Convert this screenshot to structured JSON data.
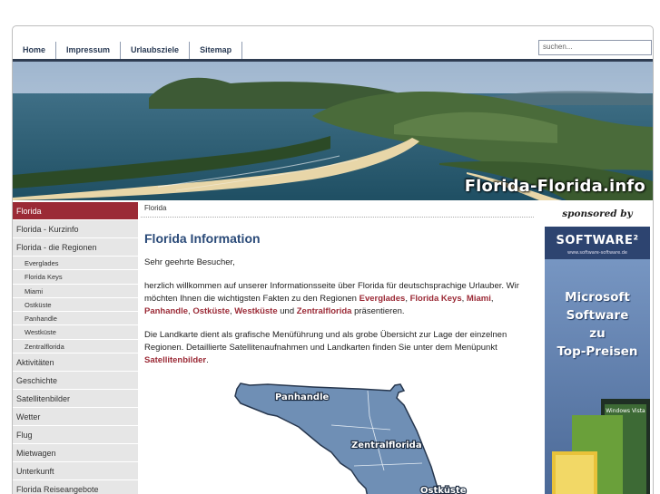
{
  "nav": {
    "items": [
      "Home",
      "Impressum",
      "Urlaubsziele",
      "Sitemap"
    ],
    "search_placeholder": "suchen..."
  },
  "banner": {
    "title": "Florida-Florida.info"
  },
  "sidebar": {
    "items": [
      {
        "label": "Florida",
        "type": "main",
        "active": true
      },
      {
        "label": "Florida - Kurzinfo",
        "type": "main"
      },
      {
        "label": "Florida - die Regionen",
        "type": "main"
      },
      {
        "label": "Everglades",
        "type": "sub"
      },
      {
        "label": "Florida Keys",
        "type": "sub"
      },
      {
        "label": "Miami",
        "type": "sub"
      },
      {
        "label": "Ostküste",
        "type": "sub"
      },
      {
        "label": "Panhandle",
        "type": "sub"
      },
      {
        "label": "Westküste",
        "type": "sub"
      },
      {
        "label": "Zentralflorida",
        "type": "sub"
      },
      {
        "label": "Aktivitäten",
        "type": "main"
      },
      {
        "label": "Geschichte",
        "type": "main"
      },
      {
        "label": "Satellitenbilder",
        "type": "main"
      },
      {
        "label": "Wetter",
        "type": "main"
      },
      {
        "label": "Flug",
        "type": "main"
      },
      {
        "label": "Mietwagen",
        "type": "main"
      },
      {
        "label": "Unterkunft",
        "type": "main"
      },
      {
        "label": "Florida Reiseangebote",
        "type": "main"
      }
    ]
  },
  "content": {
    "breadcrumb": "Florida",
    "title": "Florida Information",
    "greeting": "Sehr geehrte Besucher,",
    "intro_pre": "herzlich willkommen auf unserer Informationsseite über Florida für deutschsprachige Urlauber. Wir möchten Ihnen die wichtigsten Fakten zu den Regionen ",
    "regions": [
      "Everglades",
      "Florida Keys",
      "Miami",
      "Panhandle",
      "Ostküste",
      "Westküste",
      "Zentralflorida"
    ],
    "sep_comma": ", ",
    "sep_and": " und ",
    "intro_post": " präsentieren.",
    "map_pre": "Die Landkarte dient als grafische Menüführung und als grobe Übersicht zur Lage der einzelnen Regionen. Detaillierte Satellitenaufnahmen und Landkarten finden Sie unter dem Menüpunkt ",
    "map_link": "Satellitenbilder",
    "map_post": ".",
    "map_labels": {
      "panhandle": "Panhandle",
      "zentral": "Zentralflorida",
      "ost": "Ostküste"
    }
  },
  "sponsor": {
    "heading": "sponsored by",
    "logo": "SOFTWARE²",
    "logo_sub": "www.software-software.de",
    "lines": [
      "Microsoft",
      "Software",
      "zu",
      "Top-Preisen"
    ],
    "box_label": "Windows Vista"
  },
  "colors": {
    "accent": "#9b2a36",
    "nav_text": "#2a3b55",
    "title": "#2a4a78",
    "map": "#6f8fb5"
  }
}
